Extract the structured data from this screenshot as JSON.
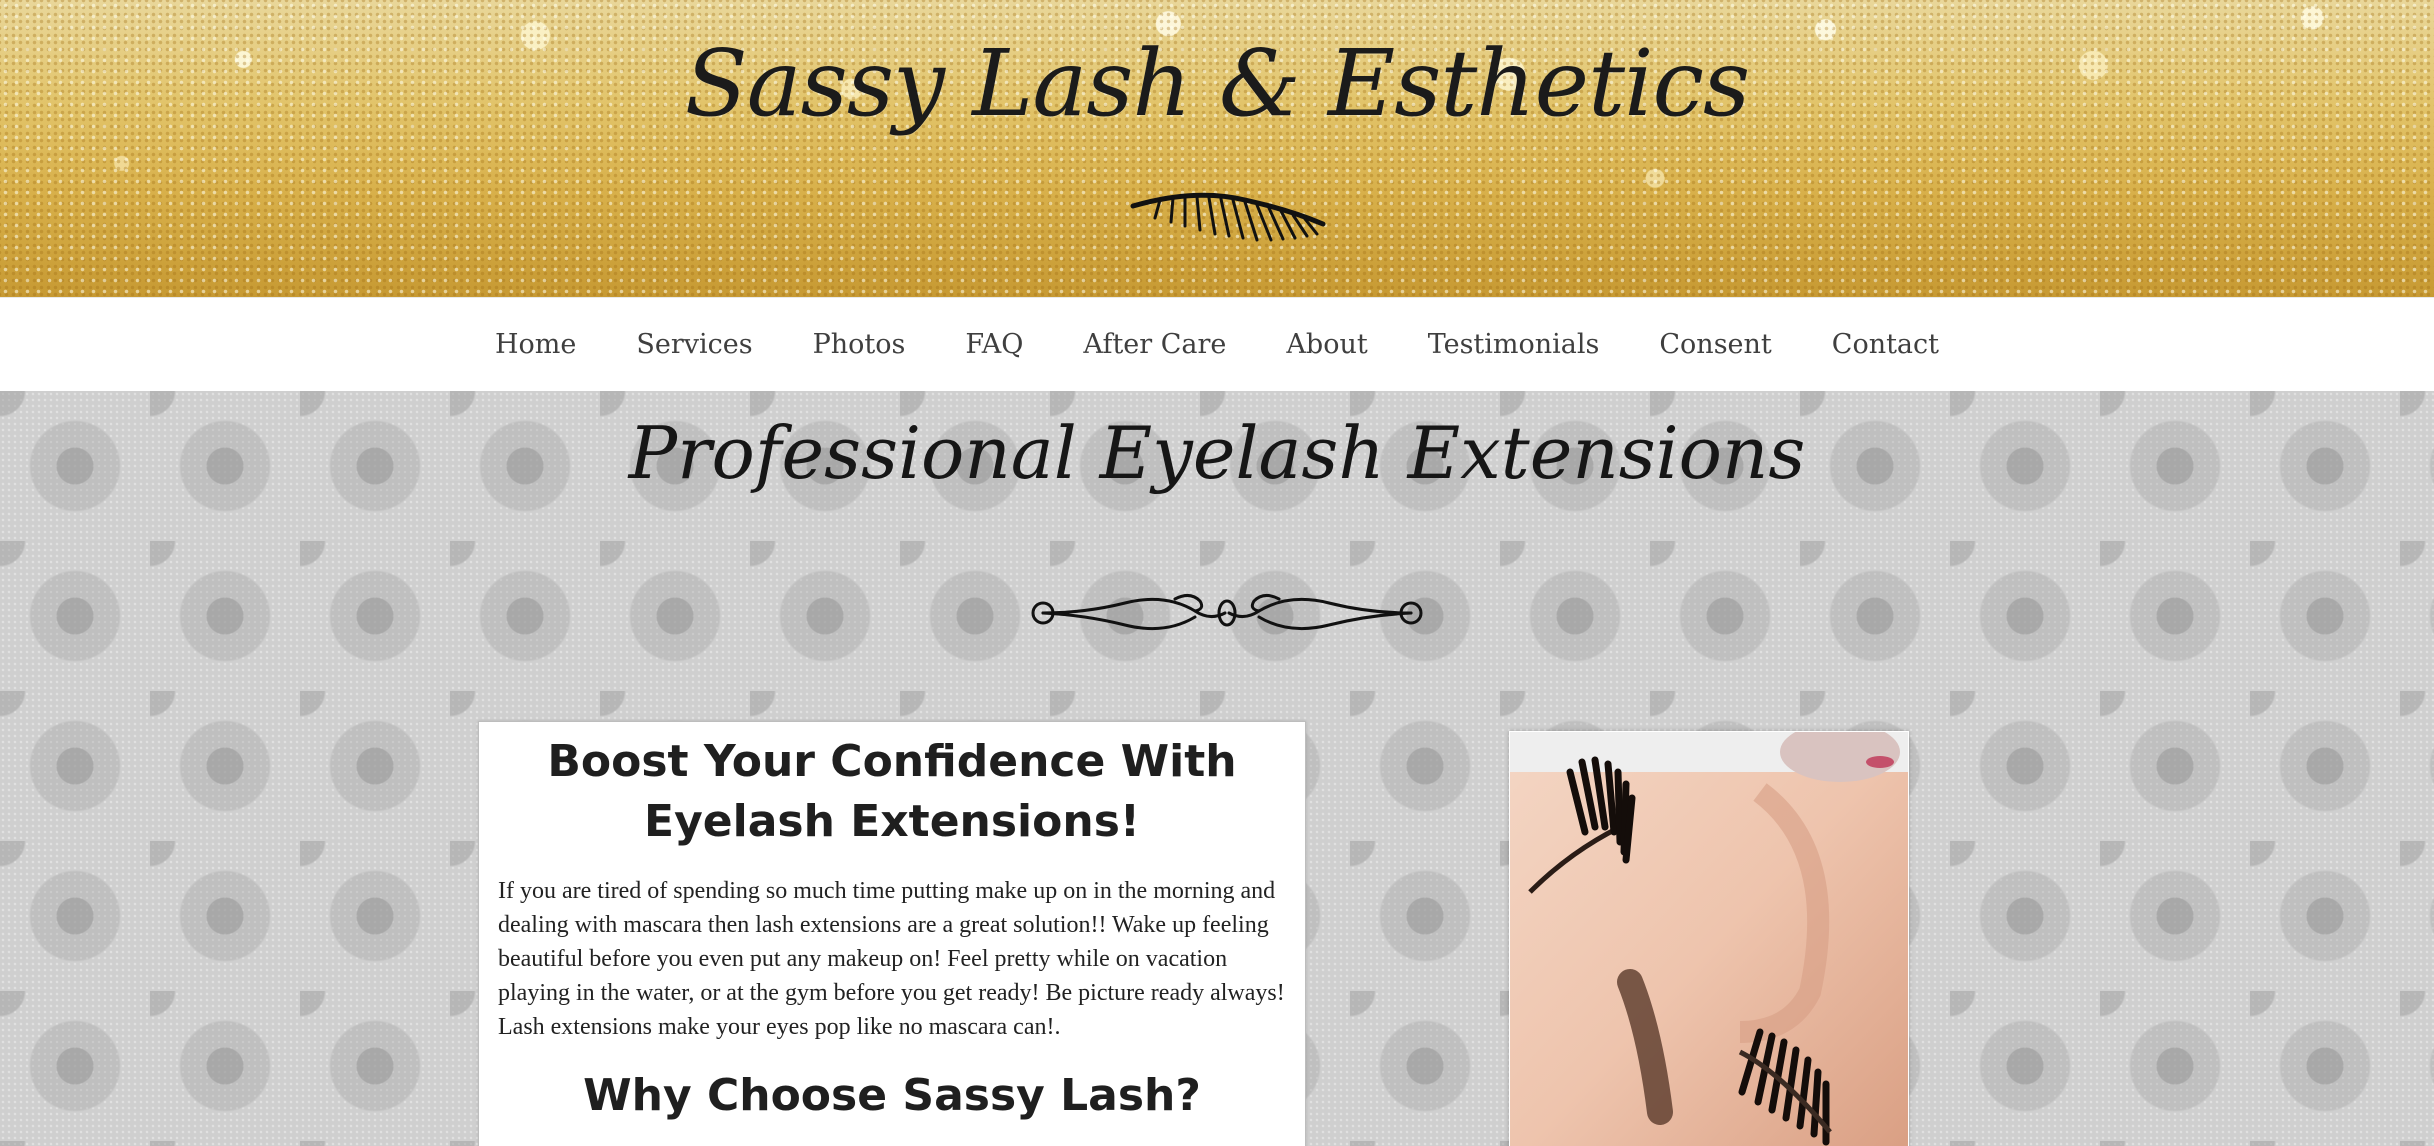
{
  "header": {
    "site_title": "Sassy Lash & Esthetics",
    "logo_icon": "eyelash-icon"
  },
  "nav": {
    "items": [
      {
        "label": "Home"
      },
      {
        "label": "Services"
      },
      {
        "label": "Photos"
      },
      {
        "label": "FAQ"
      },
      {
        "label": "After Care"
      },
      {
        "label": "About"
      },
      {
        "label": "Testimonials"
      },
      {
        "label": "Consent"
      },
      {
        "label": "Contact"
      }
    ]
  },
  "main": {
    "heading": "Professional Eyelash Extensions",
    "divider_icon": "flourish-divider-icon",
    "card": {
      "title": "Boost Your Confidence With Eyelash Extensions!",
      "body": "If you are tired of spending so much time putting make up on in the morning and dealing with mascara then lash extensions are a great solution!! Wake up feeling beautiful before you even put any makeup on! Feel pretty while on vacation playing in the water, or at the gym before you get ready! Be picture ready always! Lash extensions make your eyes pop like no mascara can!.",
      "subtitle": "Why Choose Sassy Lash?"
    },
    "photo": {
      "subject": "eyelash-extensions-closeup-photo"
    }
  },
  "colors": {
    "gold_header": "#d8b04a",
    "nav_background": "#ffffff",
    "nav_text": "#3f3f3f",
    "damask_background": "#cfcfcf",
    "heading_text": "#161616"
  }
}
